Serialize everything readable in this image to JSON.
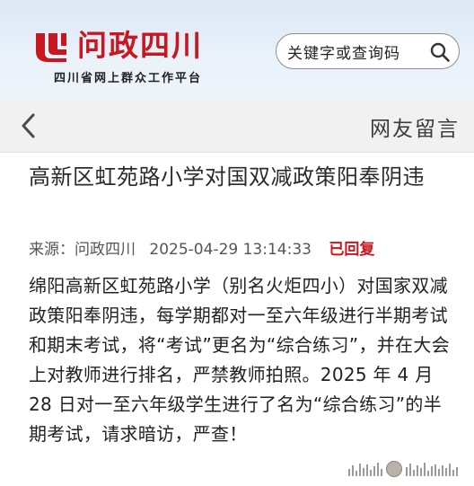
{
  "header": {
    "site_name": "问政四川",
    "site_subtitle": "四川省网上群众工作平台",
    "search": {
      "placeholder": "关键字或查询码",
      "icon": "search-icon"
    },
    "logo_icon": "wenzheng-sichuan-logo",
    "brand_color": "#c8171f"
  },
  "nav": {
    "back_icon": "chevron-left-icon",
    "title": "网友留言"
  },
  "article": {
    "title": "高新区虹苑路小学对国双减政策阳奉阴违",
    "source_label": "来源：问政四川",
    "timestamp": "2025-04-29 13:14:33",
    "status": "已回复",
    "body": "绵阳高新区虹苑路小学（别名火炬四小）对国家双减政策阳奉阴违，每学期都对一至六年级进行半期考试和期末考试，将“考试”更名为“综合练习”，并在大会上对教师进行排名，严禁教师拍照。2025 年 4 月 28 日对一至六年级学生进行了名为“综合练习”的半期考试，请求暗访，严查！"
  }
}
